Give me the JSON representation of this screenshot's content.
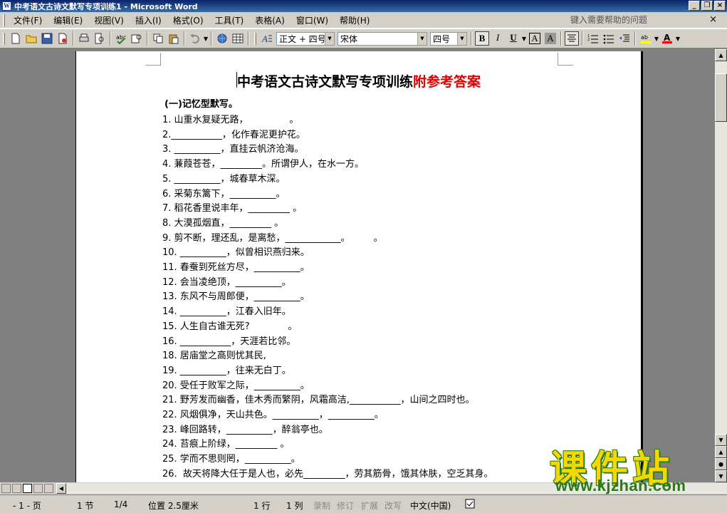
{
  "window": {
    "title": "中考语文古诗文默写专项训练1 - Microsoft Word",
    "app_icon": "W"
  },
  "menu": {
    "items": [
      "文件(F)",
      "编辑(E)",
      "视图(V)",
      "插入(I)",
      "格式(O)",
      "工具(T)",
      "表格(A)",
      "窗口(W)",
      "帮助(H)"
    ],
    "help_placeholder": "键入需要帮助的问题",
    "close_glyph": "×"
  },
  "toolbar": {
    "style_value": "正文 + 四号",
    "font_value": "宋体",
    "size_value": "四号",
    "bold_label": "B",
    "italic_label": "I",
    "underline_label": "U",
    "char_border_label": "A",
    "char_shade_label": "A",
    "font_color_label": "A",
    "highlight_color": "#ffff00",
    "font_color": "#ff0000"
  },
  "document": {
    "title_black": "中考语文古诗文默写专项训练",
    "title_red": "附参考答案",
    "title_red_color": "#e00000",
    "section_heading": "(一)记忆型默写。",
    "lines": [
      "1. 山重水复疑无路，              。",
      "2.___________，化作春泥更护花。",
      "3. __________，直挂云帆济沧海。",
      "4. 蒹葭苍苍，_________。所谓伊人，在水一方。",
      "5. __________，城春草木深。",
      "6. 采菊东篱下，__________。",
      "7. 稻花香里说丰年，_________ 。",
      "8. 大漠孤烟直，_________ 。",
      "9. 剪不断，理还乱，是离愁，____________。        。",
      "10. __________，似曾相识燕归来。",
      "11. 春蚕到死丝方尽，__________。",
      "12. 会当凌绝顶，__________。",
      "13. 东风不与周郎便，__________。",
      "14. __________，江春入旧年。",
      "15. 人生自古谁无死?             。",
      "16. ___________，天涯若比邻。",
      "18. 居庙堂之高则忧其民,",
      "19. __________，往来无白丁。",
      "20. 受任于败军之际，__________。",
      "21. 野芳发而幽香，佳木秀而繁阴，风霜高洁,___________，山间之四时也。",
      "22. 风烟俱净，天山共色。__________，__________。",
      "23. 峰回路转，__________，醉翁亭也。",
      "24. 苔痕上阶绿，_________ 。",
      "25. 学而不思则罔，__________。",
      "26.  故天将降大任于是人也，必先_________，劳其筋骨，饿其体肤，空乏其身。"
    ]
  },
  "status": {
    "page": "- 1 - 页",
    "section": "1 节",
    "page_of": "1/4",
    "position": "位置 2.5厘米",
    "line": "1 行",
    "column": "1 列",
    "rec": "录制",
    "trk": "修订",
    "ext": "扩展",
    "ovr": "改写",
    "language": "中文(中国)"
  },
  "watermark": {
    "text": "课件站",
    "url": "www.kjzhan.com"
  }
}
